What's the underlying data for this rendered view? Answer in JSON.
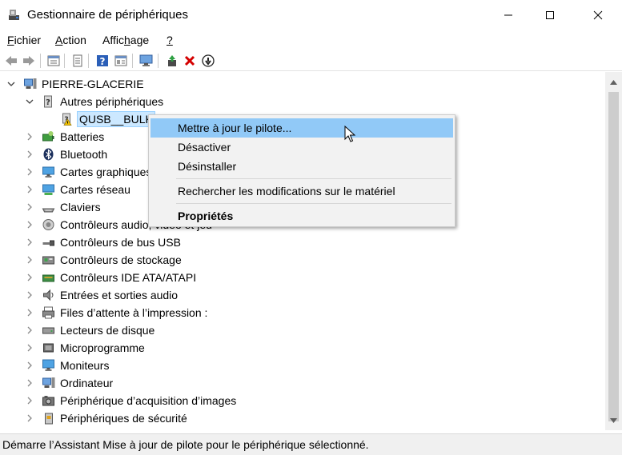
{
  "window": {
    "title": "Gestionnaire de périphériques",
    "controls": {
      "minimize": "minimize-icon",
      "maximize": "maximize-icon",
      "close": "close-icon"
    }
  },
  "menubar": {
    "items": [
      {
        "label": "Fichier",
        "accel_index": 0
      },
      {
        "label": "Action",
        "accel_index": 0
      },
      {
        "label": "Affichage",
        "accel_index": 5
      },
      {
        "label": "?",
        "accel_index": 0
      }
    ]
  },
  "toolbar": {
    "buttons": [
      "back-icon",
      "forward-icon",
      "properties-icon",
      "view-icon",
      "help-icon",
      "action-list-icon",
      "scan-hardware-icon",
      "update-driver-icon",
      "uninstall-icon",
      "disable-icon"
    ]
  },
  "tree": {
    "root": "PIERRE-GLACERIE",
    "items": [
      {
        "label": "PIERRE-GLACERIE",
        "level": 0,
        "expanded": true,
        "icon": "computer-icon"
      },
      {
        "label": "Autres périphériques",
        "level": 1,
        "expanded": true,
        "icon": "unknown-device-icon"
      },
      {
        "label": "QUSB__BULK",
        "level": 2,
        "selected": true,
        "icon": "warning-device-icon"
      },
      {
        "label": "Batteries",
        "level": 1,
        "icon": "battery-icon"
      },
      {
        "label": "Bluetooth",
        "level": 1,
        "icon": "bluetooth-icon"
      },
      {
        "label": "Cartes graphiques",
        "level": 1,
        "icon": "display-adapter-icon"
      },
      {
        "label": "Cartes réseau",
        "level": 1,
        "icon": "network-adapter-icon"
      },
      {
        "label": "Claviers",
        "level": 1,
        "icon": "keyboard-icon"
      },
      {
        "label": "Contrôleurs audio, vidéo et jeu",
        "level": 1,
        "icon": "audio-icon"
      },
      {
        "label": "Contrôleurs de bus USB",
        "level": 1,
        "icon": "usb-icon"
      },
      {
        "label": "Contrôleurs de stockage",
        "level": 1,
        "icon": "storage-controller-icon"
      },
      {
        "label": "Contrôleurs IDE ATA/ATAPI",
        "level": 1,
        "icon": "ide-icon"
      },
      {
        "label": "Entrées et sorties audio",
        "level": 1,
        "icon": "audio-io-icon"
      },
      {
        "label": "Files d’attente à l’impression :",
        "level": 1,
        "icon": "printer-queue-icon"
      },
      {
        "label": "Lecteurs de disque",
        "level": 1,
        "icon": "disk-drive-icon"
      },
      {
        "label": "Microprogramme",
        "level": 1,
        "icon": "firmware-icon"
      },
      {
        "label": "Moniteurs",
        "level": 1,
        "icon": "monitor-icon"
      },
      {
        "label": "Ordinateur",
        "level": 1,
        "icon": "computer-icon"
      },
      {
        "label": "Périphérique d’acquisition d’images",
        "level": 1,
        "icon": "imaging-icon"
      },
      {
        "label": "Périphériques de sécurité",
        "level": 1,
        "icon": "security-icon"
      }
    ]
  },
  "context_menu": {
    "items": [
      {
        "label": "Mettre à jour le pilote...",
        "highlighted": true
      },
      {
        "label": "Désactiver"
      },
      {
        "label": "Désinstaller"
      },
      {
        "separator": true
      },
      {
        "label": "Rechercher les modifications sur le matériel"
      },
      {
        "separator": true
      },
      {
        "label": "Propriétés",
        "bold": true
      }
    ]
  },
  "statusbar": {
    "text": "Démarre l’Assistant Mise à jour de pilote pour le périphérique sélectionné."
  },
  "colors": {
    "context_highlight": "#91c9f7",
    "selection": "#cce8ff",
    "statusbar_bg": "#f0f0f0",
    "delete_red": "#d40000"
  }
}
